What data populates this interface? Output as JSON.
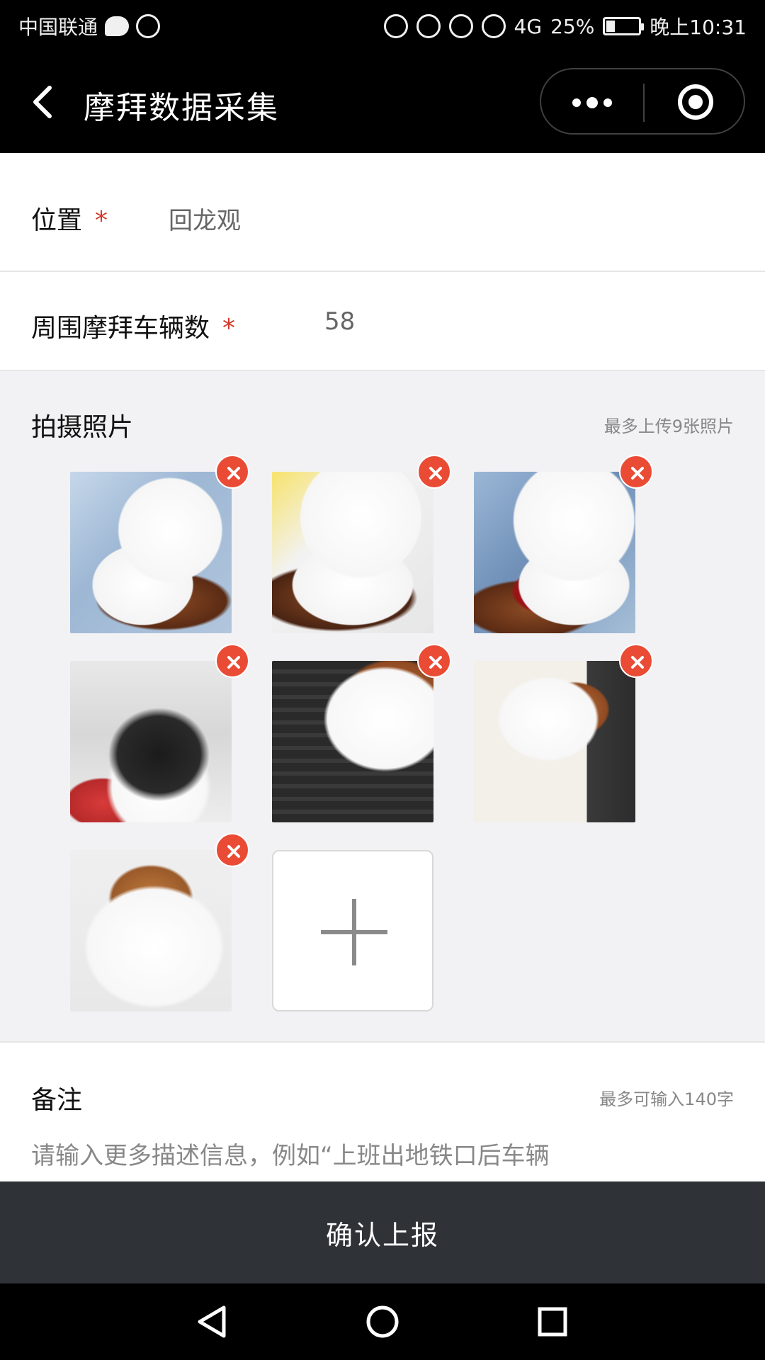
{
  "status_bar": {
    "carrier": "中国联通",
    "network": "4G",
    "battery": "25%",
    "battery_level": 0.25,
    "time": "晚上10:31"
  },
  "nav_bar": {
    "title": "摩拜数据采集",
    "icons": {
      "back": "back-icon",
      "more": "more-icon",
      "target": "target-icon"
    }
  },
  "form": {
    "location": {
      "label": "位置",
      "required_mark": "*",
      "value": "回龙观"
    },
    "vehicle_count": {
      "label": "周围摩拜车辆数",
      "required_mark": "*",
      "value": "58"
    }
  },
  "photos": {
    "title": "拍摄照片",
    "hint": "最多上传9张照片",
    "items": [
      {
        "icon": "cat-photo"
      },
      {
        "icon": "cat-photo"
      },
      {
        "icon": "cat-photo"
      },
      {
        "icon": "cat-photo"
      },
      {
        "icon": "cat-photo"
      },
      {
        "icon": "cat-photo"
      },
      {
        "icon": "cat-photo"
      }
    ],
    "add_icon": "plus-icon",
    "remove_icon": "close-icon",
    "remove_color": "#ea4b35"
  },
  "notes": {
    "title": "备注",
    "hint": "最多可输入140字",
    "placeholder": "请输入更多描述信息，例如“上班出地铁口后车辆"
  },
  "submit": {
    "label": "确认上报",
    "background": "#2f3237"
  },
  "system_nav": {
    "icons": [
      "back-triangle-icon",
      "home-circle-icon",
      "recent-square-icon"
    ]
  }
}
